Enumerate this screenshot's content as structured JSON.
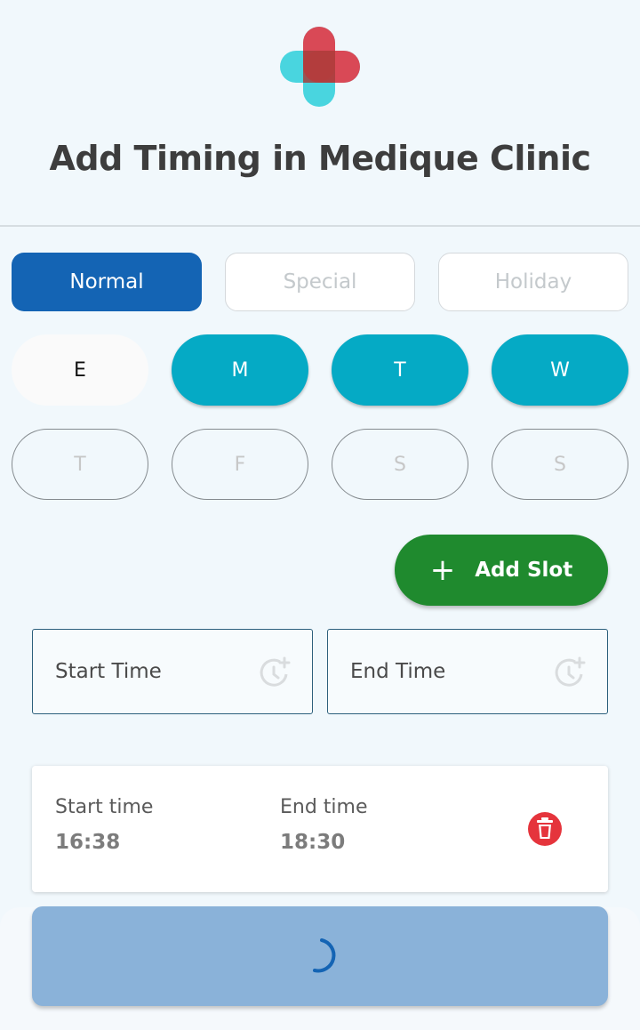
{
  "header": {
    "logo_icon": "medical-cross-icon",
    "title": "Add Timing in Medique Clinic"
  },
  "mode_tabs": [
    {
      "label": "Normal",
      "active": true
    },
    {
      "label": "Special",
      "active": false
    },
    {
      "label": "Holiday",
      "active": false
    }
  ],
  "days": [
    {
      "label": "E",
      "state": "current"
    },
    {
      "label": "M",
      "state": "selected"
    },
    {
      "label": "T",
      "state": "selected"
    },
    {
      "label": "W",
      "state": "selected"
    },
    {
      "label": "T",
      "state": "off"
    },
    {
      "label": "F",
      "state": "off"
    },
    {
      "label": "S",
      "state": "off"
    },
    {
      "label": "S",
      "state": "off"
    }
  ],
  "add_slot": {
    "label": "Add Slot",
    "icon": "plus-icon"
  },
  "fields": {
    "start": {
      "placeholder": "Start Time",
      "icon": "clock-add-icon"
    },
    "end": {
      "placeholder": "End Time",
      "icon": "clock-add-icon"
    }
  },
  "slot": {
    "start_label": "Start time",
    "start_value": "16:38",
    "end_label": "End time",
    "end_value": "18:30",
    "delete_icon": "trash-icon"
  },
  "submit": {
    "state": "loading",
    "icon": "spinner-icon"
  },
  "colors": {
    "primary": "#1464b4",
    "day_selected": "#05aac5",
    "add_slot": "#1f8a2e",
    "delete": "#e5343c",
    "submit_loading": "#8ab2d9"
  }
}
